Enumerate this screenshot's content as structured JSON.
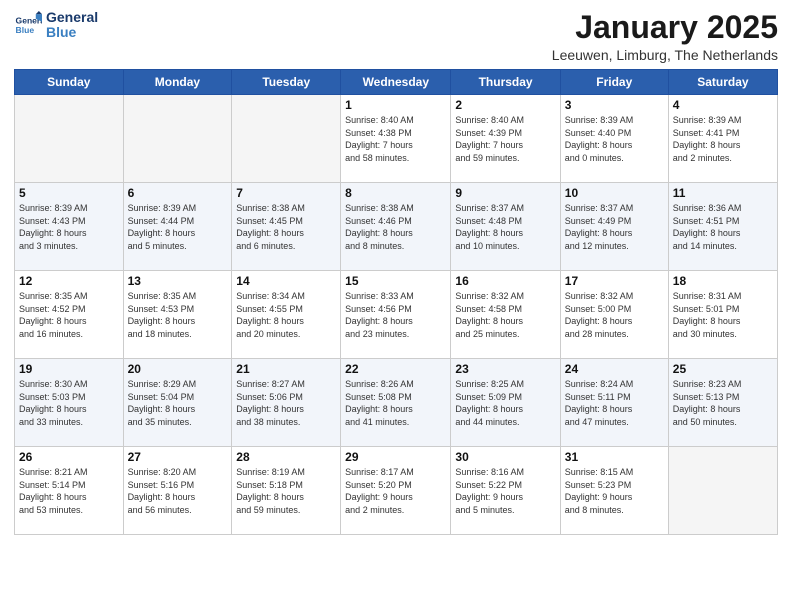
{
  "header": {
    "logo_text_general": "General",
    "logo_text_blue": "Blue",
    "month_title": "January 2025",
    "location": "Leeuwen, Limburg, The Netherlands"
  },
  "days_of_week": [
    "Sunday",
    "Monday",
    "Tuesday",
    "Wednesday",
    "Thursday",
    "Friday",
    "Saturday"
  ],
  "weeks": [
    [
      {
        "day": "",
        "info": ""
      },
      {
        "day": "",
        "info": ""
      },
      {
        "day": "",
        "info": ""
      },
      {
        "day": "1",
        "info": "Sunrise: 8:40 AM\nSunset: 4:38 PM\nDaylight: 7 hours\nand 58 minutes."
      },
      {
        "day": "2",
        "info": "Sunrise: 8:40 AM\nSunset: 4:39 PM\nDaylight: 7 hours\nand 59 minutes."
      },
      {
        "day": "3",
        "info": "Sunrise: 8:39 AM\nSunset: 4:40 PM\nDaylight: 8 hours\nand 0 minutes."
      },
      {
        "day": "4",
        "info": "Sunrise: 8:39 AM\nSunset: 4:41 PM\nDaylight: 8 hours\nand 2 minutes."
      }
    ],
    [
      {
        "day": "5",
        "info": "Sunrise: 8:39 AM\nSunset: 4:43 PM\nDaylight: 8 hours\nand 3 minutes."
      },
      {
        "day": "6",
        "info": "Sunrise: 8:39 AM\nSunset: 4:44 PM\nDaylight: 8 hours\nand 5 minutes."
      },
      {
        "day": "7",
        "info": "Sunrise: 8:38 AM\nSunset: 4:45 PM\nDaylight: 8 hours\nand 6 minutes."
      },
      {
        "day": "8",
        "info": "Sunrise: 8:38 AM\nSunset: 4:46 PM\nDaylight: 8 hours\nand 8 minutes."
      },
      {
        "day": "9",
        "info": "Sunrise: 8:37 AM\nSunset: 4:48 PM\nDaylight: 8 hours\nand 10 minutes."
      },
      {
        "day": "10",
        "info": "Sunrise: 8:37 AM\nSunset: 4:49 PM\nDaylight: 8 hours\nand 12 minutes."
      },
      {
        "day": "11",
        "info": "Sunrise: 8:36 AM\nSunset: 4:51 PM\nDaylight: 8 hours\nand 14 minutes."
      }
    ],
    [
      {
        "day": "12",
        "info": "Sunrise: 8:35 AM\nSunset: 4:52 PM\nDaylight: 8 hours\nand 16 minutes."
      },
      {
        "day": "13",
        "info": "Sunrise: 8:35 AM\nSunset: 4:53 PM\nDaylight: 8 hours\nand 18 minutes."
      },
      {
        "day": "14",
        "info": "Sunrise: 8:34 AM\nSunset: 4:55 PM\nDaylight: 8 hours\nand 20 minutes."
      },
      {
        "day": "15",
        "info": "Sunrise: 8:33 AM\nSunset: 4:56 PM\nDaylight: 8 hours\nand 23 minutes."
      },
      {
        "day": "16",
        "info": "Sunrise: 8:32 AM\nSunset: 4:58 PM\nDaylight: 8 hours\nand 25 minutes."
      },
      {
        "day": "17",
        "info": "Sunrise: 8:32 AM\nSunset: 5:00 PM\nDaylight: 8 hours\nand 28 minutes."
      },
      {
        "day": "18",
        "info": "Sunrise: 8:31 AM\nSunset: 5:01 PM\nDaylight: 8 hours\nand 30 minutes."
      }
    ],
    [
      {
        "day": "19",
        "info": "Sunrise: 8:30 AM\nSunset: 5:03 PM\nDaylight: 8 hours\nand 33 minutes."
      },
      {
        "day": "20",
        "info": "Sunrise: 8:29 AM\nSunset: 5:04 PM\nDaylight: 8 hours\nand 35 minutes."
      },
      {
        "day": "21",
        "info": "Sunrise: 8:27 AM\nSunset: 5:06 PM\nDaylight: 8 hours\nand 38 minutes."
      },
      {
        "day": "22",
        "info": "Sunrise: 8:26 AM\nSunset: 5:08 PM\nDaylight: 8 hours\nand 41 minutes."
      },
      {
        "day": "23",
        "info": "Sunrise: 8:25 AM\nSunset: 5:09 PM\nDaylight: 8 hours\nand 44 minutes."
      },
      {
        "day": "24",
        "info": "Sunrise: 8:24 AM\nSunset: 5:11 PM\nDaylight: 8 hours\nand 47 minutes."
      },
      {
        "day": "25",
        "info": "Sunrise: 8:23 AM\nSunset: 5:13 PM\nDaylight: 8 hours\nand 50 minutes."
      }
    ],
    [
      {
        "day": "26",
        "info": "Sunrise: 8:21 AM\nSunset: 5:14 PM\nDaylight: 8 hours\nand 53 minutes."
      },
      {
        "day": "27",
        "info": "Sunrise: 8:20 AM\nSunset: 5:16 PM\nDaylight: 8 hours\nand 56 minutes."
      },
      {
        "day": "28",
        "info": "Sunrise: 8:19 AM\nSunset: 5:18 PM\nDaylight: 8 hours\nand 59 minutes."
      },
      {
        "day": "29",
        "info": "Sunrise: 8:17 AM\nSunset: 5:20 PM\nDaylight: 9 hours\nand 2 minutes."
      },
      {
        "day": "30",
        "info": "Sunrise: 8:16 AM\nSunset: 5:22 PM\nDaylight: 9 hours\nand 5 minutes."
      },
      {
        "day": "31",
        "info": "Sunrise: 8:15 AM\nSunset: 5:23 PM\nDaylight: 9 hours\nand 8 minutes."
      },
      {
        "day": "",
        "info": ""
      }
    ]
  ]
}
